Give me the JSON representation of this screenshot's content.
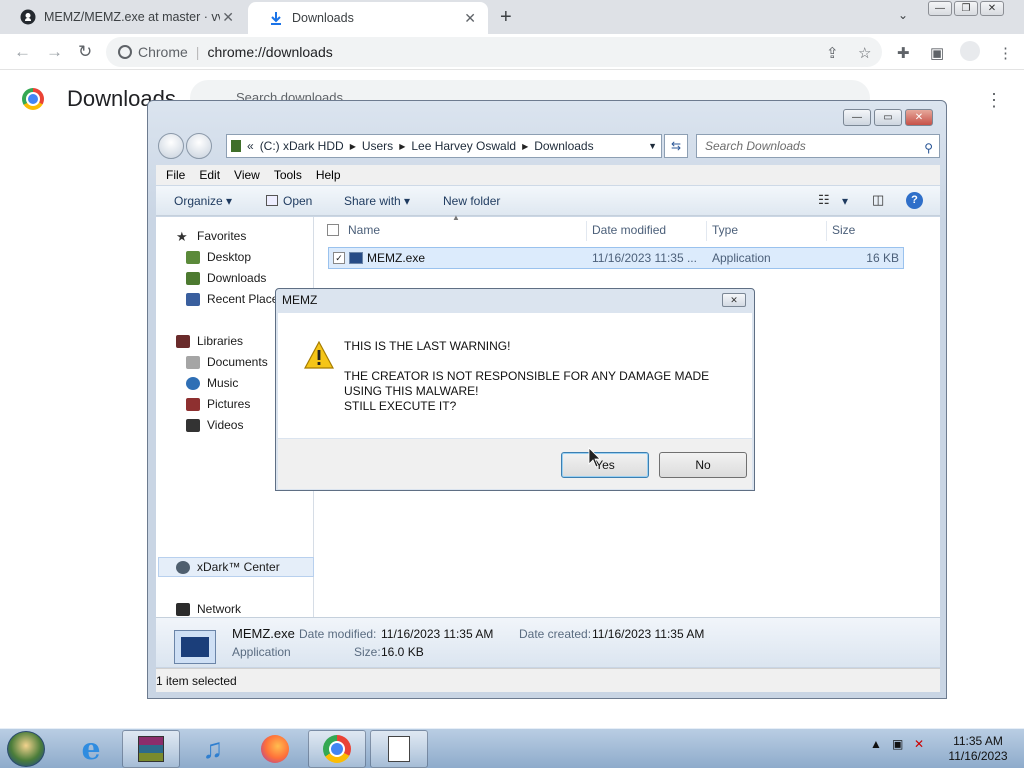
{
  "chrome": {
    "tabs": [
      {
        "title": "MEMZ/MEMZ.exe at master · vvi",
        "icon": "github-icon",
        "close": "✕"
      },
      {
        "title": "Downloads",
        "icon": "download-icon",
        "close": "✕"
      }
    ],
    "new_tab": "+",
    "tab_search": "⌄",
    "window_controls": [
      "—",
      "❐",
      "✕"
    ],
    "omnibox": {
      "site": "Chrome",
      "separator": "|",
      "url": "chrome://downloads"
    },
    "page_title": "Downloads",
    "search_placeholder": "Search downloads",
    "more_menu": "⋮"
  },
  "explorer": {
    "window_controls": [
      "—",
      "▭",
      "✕"
    ],
    "breadcrumb": {
      "prefix": "«",
      "items": [
        "(C:) xDark HDD",
        "Users",
        "Lee Harvey Oswald",
        "Downloads"
      ]
    },
    "search_placeholder": "Search Downloads",
    "menu": [
      "File",
      "Edit",
      "View",
      "Tools",
      "Help"
    ],
    "commands": {
      "organize": "Organize ▾",
      "open": "Open",
      "share": "Share with ▾",
      "new_folder": "New folder",
      "view_arrow": "▾",
      "help": "?"
    },
    "nav": {
      "favorites": "Favorites",
      "desktop": "Desktop",
      "downloads": "Downloads",
      "recent": "Recent Places",
      "libraries": "Libraries",
      "documents": "Documents",
      "music": "Music",
      "pictures": "Pictures",
      "videos": "Videos",
      "computer": "xDark™ Center",
      "network": "Network"
    },
    "columns": {
      "name": "Name",
      "date": "Date modified",
      "type": "Type",
      "size": "Size"
    },
    "files": [
      {
        "name": "MEMZ.exe",
        "date": "11/16/2023 11:35 ...",
        "type": "Application",
        "size": "16 KB",
        "checked": "✓"
      }
    ],
    "details": {
      "name": "MEMZ.exe",
      "type": "Application",
      "date_modified_label": "Date modified:",
      "date_modified": "11/16/2023 11:35 AM",
      "date_created_label": "Date created:",
      "date_created": "11/16/2023 11:35 AM",
      "size_label": "Size:",
      "size": "16.0 KB"
    },
    "status": "1 item selected"
  },
  "dialog": {
    "title": "MEMZ",
    "close": "✕",
    "line1": "THIS IS THE LAST WARNING!",
    "line2": "THE CREATOR IS NOT RESPONSIBLE FOR ANY DAMAGE MADE USING THIS MALWARE!",
    "line3": "STILL EXECUTE IT?",
    "yes": "Yes",
    "no": "No"
  },
  "taskbar": {
    "time": "11:35 AM",
    "date": "11/16/2023",
    "colors": {
      "accent": "#2f6fc9"
    }
  }
}
